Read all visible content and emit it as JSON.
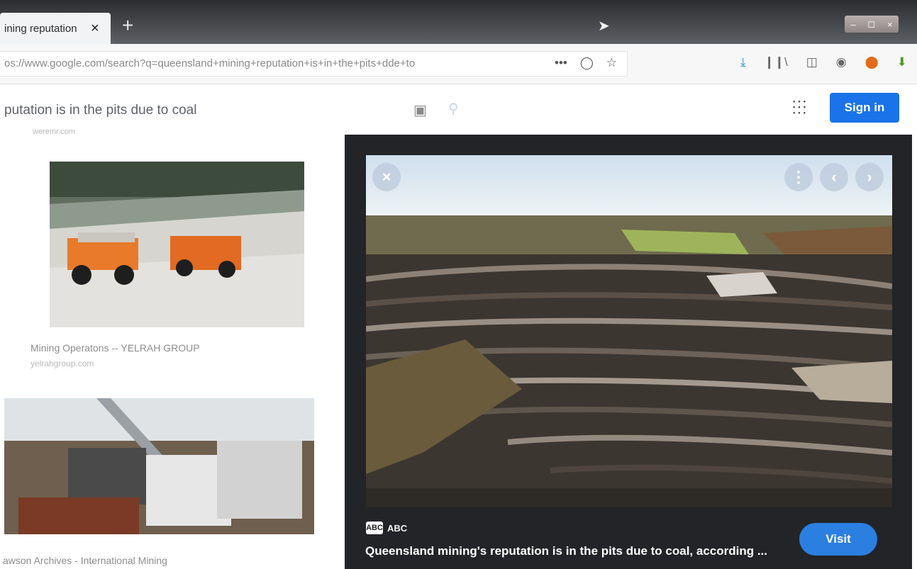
{
  "browser": {
    "tab_title": "ining reputation",
    "tab_close": "×",
    "new_tab": "+",
    "window_controls": [
      "–",
      "◻",
      "×"
    ],
    "url": "os://www.google.com/search?q=queensland+mining+reputation+is+in+the+pits+dde+to",
    "url_actions": [
      "•••",
      "pocket-icon",
      "star-icon"
    ],
    "toolbar_icons": [
      "download-icon",
      "library-icon",
      "sidebar-icon",
      "account-icon",
      "extension-icon",
      "extension-icon"
    ]
  },
  "google": {
    "query": "putation is in the pits due to coal",
    "sign_in_label": "Sign in",
    "accent": "#1a73e8"
  },
  "results": {
    "cropped_source": "weremr.com",
    "items": [
      {
        "caption": "Mining Operatons -- YELRAH GROUP",
        "source": "yelrahgroup.com"
      },
      {
        "caption": "awson Archives - International Mining",
        "source": ""
      }
    ]
  },
  "preview": {
    "source_logo": "ABC",
    "source_name": "ABC",
    "title": "Queensland mining's reputation is in the pits due to coal, according ...",
    "visit_label": "Visit",
    "close_glyph": "×",
    "more_glyph": "⋮",
    "prev_glyph": "‹",
    "next_glyph": "›"
  }
}
